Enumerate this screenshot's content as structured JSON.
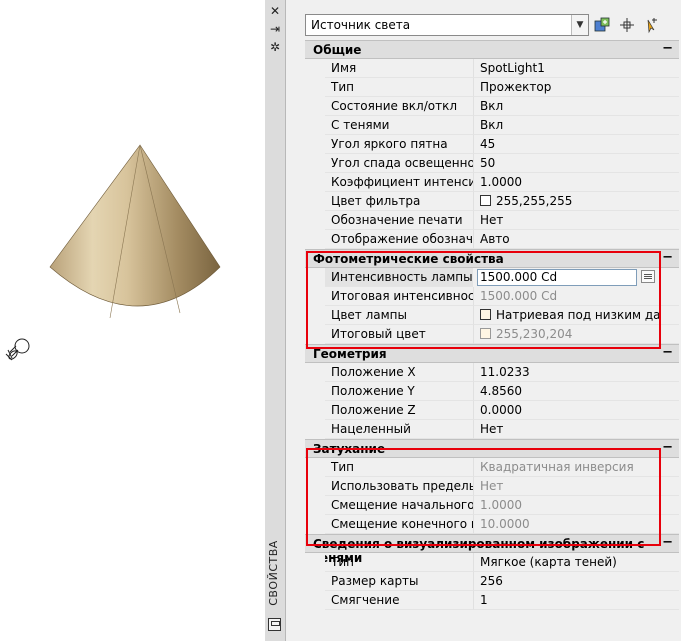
{
  "palette": {
    "title": "СВОЙСТВА",
    "selector_value": "Источник света",
    "titlebar_buttons": [
      "✕",
      "⇥",
      "✲"
    ]
  },
  "sections": {
    "general": {
      "title": "Общие",
      "toggle": "−",
      "rows": [
        {
          "name": "Имя",
          "value": "SpotLight1"
        },
        {
          "name": "Тип",
          "value": "Прожектор"
        },
        {
          "name": "Состояние вкл/откл",
          "value": "Вкл"
        },
        {
          "name": "С тенями",
          "value": "Вкл"
        },
        {
          "name": "Угол яркого пятна",
          "value": "45"
        },
        {
          "name": "Угол спада освещенност",
          "value": "50"
        },
        {
          "name": "Коэффициент интенсив",
          "value": "1.0000"
        },
        {
          "name": "Цвет фильтра",
          "value": "255,255,255"
        },
        {
          "name": "Обозначение печати",
          "value": "Нет"
        },
        {
          "name": "Отображение обозначе",
          "value": "Авто"
        }
      ]
    },
    "photometric": {
      "title": "Фотометрические свойства",
      "toggle": "−",
      "rows": [
        {
          "name": "Интенсивность лампы",
          "value": "1500.000 Cd"
        },
        {
          "name": "Итоговая интенсивность",
          "value": "1500.000 Cd"
        },
        {
          "name": "Цвет лампы",
          "value": "Натриевая под низким да"
        },
        {
          "name": "Итоговый цвет",
          "value": "255,230,204"
        }
      ]
    },
    "geometry": {
      "title": "Геометрия",
      "toggle": "−",
      "rows": [
        {
          "name": "Положение X",
          "value": "11.0233"
        },
        {
          "name": "Положение Y",
          "value": "4.8560"
        },
        {
          "name": "Положение Z",
          "value": "0.0000"
        },
        {
          "name": "Нацеленный",
          "value": "Нет"
        }
      ]
    },
    "attenuation": {
      "title": "Затухание",
      "toggle": "−",
      "rows": [
        {
          "name": "Тип",
          "value": "Квадратичная инверсия"
        },
        {
          "name": "Использовать пределы",
          "value": "Нет"
        },
        {
          "name": "Смещение начального п",
          "value": "1.0000"
        },
        {
          "name": "Смещение конечного п",
          "value": "10.0000"
        }
      ]
    },
    "rendered_shadow": {
      "title": "Сведения о визуализированном изображении с тенями",
      "toggle": "−",
      "rows": [
        {
          "name": "Тип",
          "value": "Мягкое (карта теней)"
        },
        {
          "name": "Размер карты",
          "value": "256"
        },
        {
          "name": "Смягчение",
          "value": "1"
        }
      ]
    }
  },
  "colors": {
    "highlight_border": "#e8000b",
    "cone_light": "#e6d7b5",
    "cone_dark": "#8a7449"
  },
  "icons": {
    "tool1": "quick-select-icon",
    "tool2": "select-objects-icon",
    "tool3": "toggle-pickadd-icon",
    "light": "spotlight-glyph-icon"
  }
}
